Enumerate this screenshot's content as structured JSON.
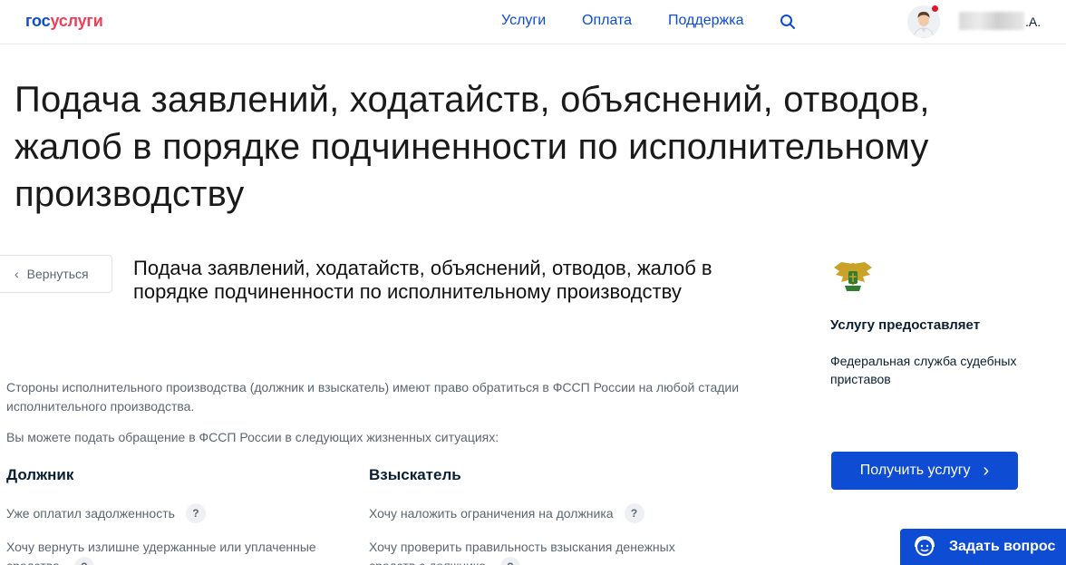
{
  "header": {
    "logo_gos": "гос",
    "logo_uslugi": "услуги",
    "nav": [
      "Услуги",
      "Оплата",
      "Поддержка"
    ],
    "user_suffix": ".А."
  },
  "page": {
    "title": "Подача заявлений, ходатайств, объяснений, отводов, жалоб в порядке подчиненности по исполнительному производству"
  },
  "back_button": {
    "label": "Вернуться"
  },
  "service": {
    "title": "Подача заявлений, ходатайств, объяснений, отводов, жалоб в порядке подчиненности по исполнительному производству",
    "intro": "Стороны исполнительного производства (должник и взыскатель) имеют право обратиться в ФССП России на любой стадии исполнительного производства.",
    "situations_intro": "Вы можете подать обращение в ФССП России в следующих жизненных ситуациях:"
  },
  "columns": {
    "debtor": {
      "heading": "Должник",
      "items": [
        "Уже оплатил задолженность",
        "Хочу вернуть излишне удержанные или уплаченные средства"
      ]
    },
    "creditor": {
      "heading": "Взыскатель",
      "items": [
        "Хочу наложить ограничения на должника",
        "Хочу проверить правильность взыскания денежных средств с должника"
      ]
    }
  },
  "sidebar": {
    "provider_label": "Услугу предоставляет",
    "provider_name": "Федеральная служба судебных приставов",
    "get_service_button": "Получить услугу"
  },
  "help_widget": {
    "label": "Задать вопрос"
  },
  "help_marker": "?",
  "colors": {
    "brand_blue": "#0d4cd3",
    "brand_red": "#ee3f58"
  }
}
